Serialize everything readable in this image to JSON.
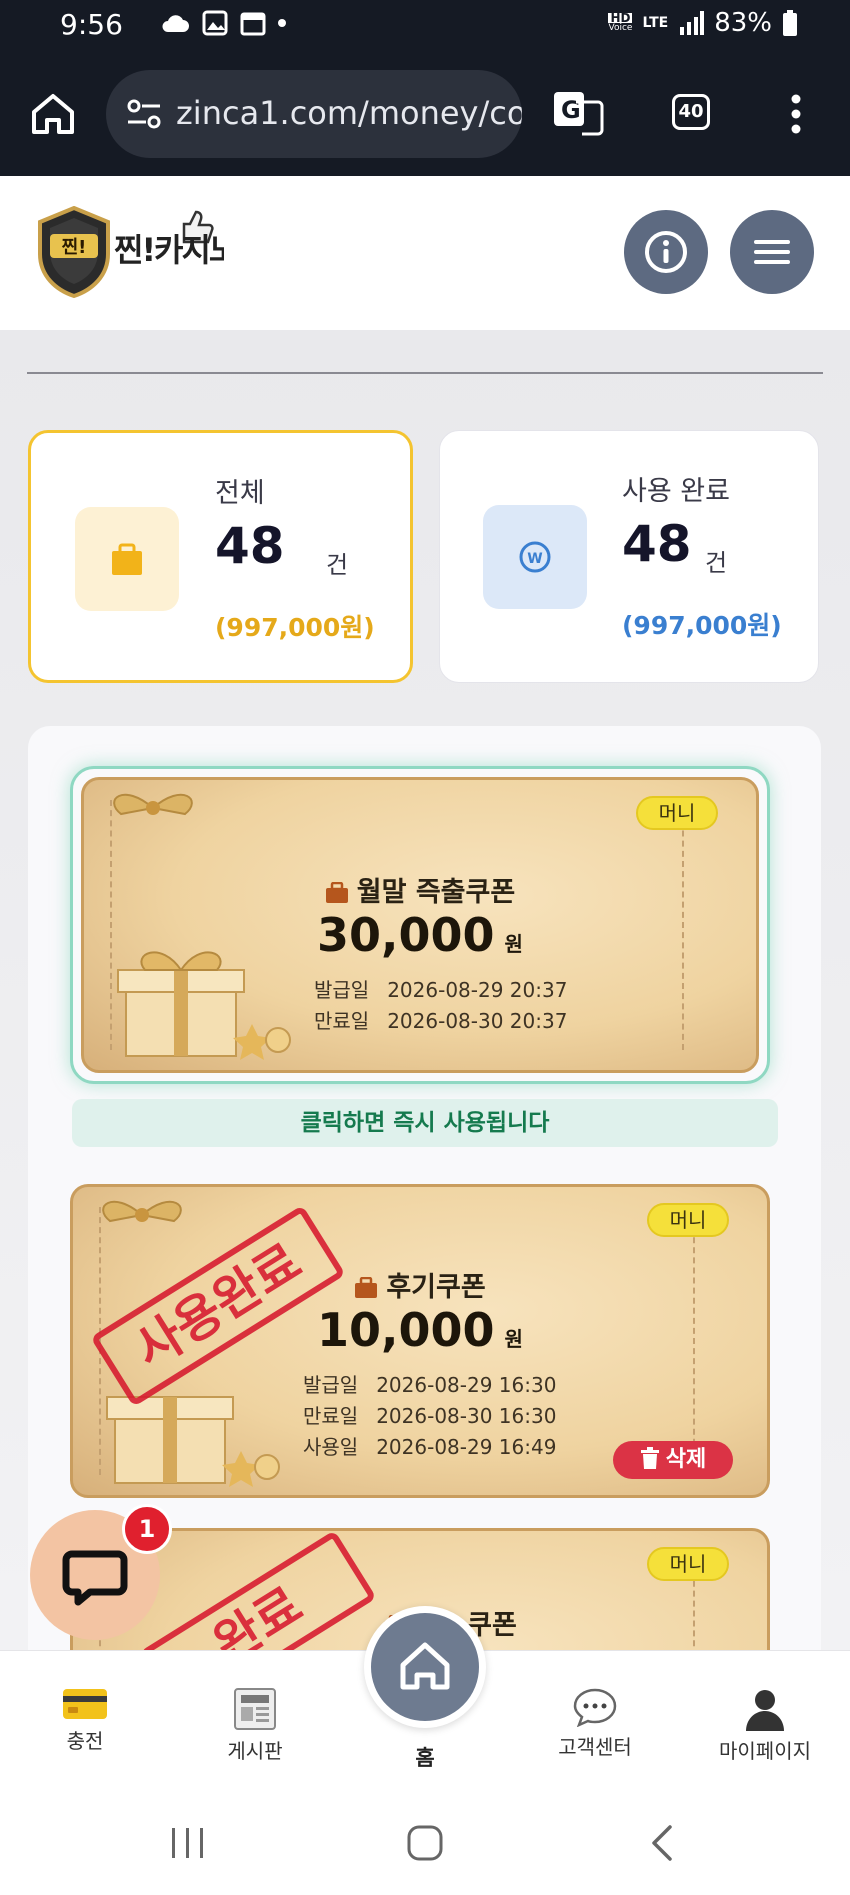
{
  "status_bar": {
    "time": "9:56",
    "network": "LTE",
    "hd_voice": "HD",
    "hd_voice_sub": "Voice",
    "battery": "83%"
  },
  "browser": {
    "url": "zinca1.com/money/co",
    "tab_count": "40"
  },
  "site": {
    "logo_text": "찐!카지노"
  },
  "stats": {
    "total": {
      "label": "전체",
      "count": "48",
      "unit": "건",
      "amount": "(997,000원)",
      "accent": "#f4c430",
      "amount_color": "#e5a91a"
    },
    "used": {
      "label": "사용 완료",
      "count": "48",
      "unit": "건",
      "amount": "(997,000원)",
      "amount_color": "#3a7fd0"
    }
  },
  "coupons": [
    {
      "badge": "머니",
      "name": "월말 즉출쿠폰",
      "amount": "30,000",
      "currency": "원",
      "issued_label": "발급일",
      "issued": "2026-08-29 20:37",
      "expires_label": "만료일",
      "expires": "2026-08-30 20:37",
      "hint": "클릭하면 즉시 사용됩니다"
    },
    {
      "badge": "머니",
      "name": "후기쿠폰",
      "amount": "10,000",
      "currency": "원",
      "issued_label": "발급일",
      "issued": "2026-08-29 16:30",
      "expires_label": "만료일",
      "expires": "2026-08-30 16:30",
      "used_label": "사용일",
      "used": "2026-08-29 16:49",
      "stamp": "사용완료",
      "delete_label": "삭제"
    },
    {
      "badge": "머니",
      "name": "쿠폰",
      "stamp": "완료"
    }
  ],
  "chat": {
    "badge_count": "1"
  },
  "bottom_nav": {
    "charge": "충전",
    "board": "게시판",
    "home": "홈",
    "support": "고객센터",
    "mypage": "마이페이지"
  }
}
